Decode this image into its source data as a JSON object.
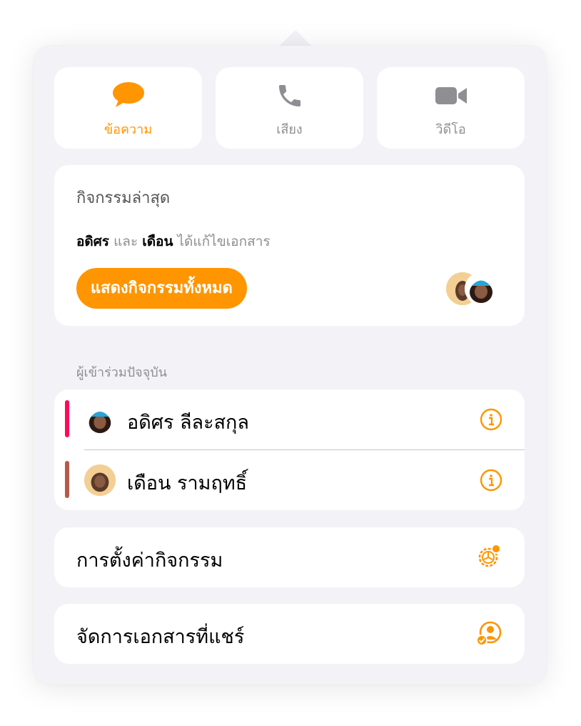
{
  "comm_buttons": [
    {
      "label": "ข้อความ",
      "icon": "message-bubble-icon",
      "active": true
    },
    {
      "label": "เสียง",
      "icon": "phone-icon",
      "active": false
    },
    {
      "label": "วิดีโอ",
      "icon": "video-camera-icon",
      "active": false
    }
  ],
  "activity": {
    "title": "กิจกรรมล่าสุด",
    "user1": "อดิศร",
    "and": "และ",
    "user2": "เดือน",
    "action": "ได้แก้ไขเอกสาร",
    "show_all_label": "แสดงกิจกรรมทั้งหมด"
  },
  "participants": {
    "header": "ผู้เข้าร่วมปัจจุบัน",
    "items": [
      {
        "name": "อดิศร ลีละสกุล",
        "color": "#ff0a5a"
      },
      {
        "name": "เดือน รามฤทธิ์",
        "color": "#b85a4b"
      }
    ]
  },
  "settings": {
    "activity_settings_label": "การตั้งค่ากิจกรรม",
    "manage_shared_label": "จัดการเอกสารที่แชร์"
  },
  "colors": {
    "accent": "#ff9500",
    "background": "#f2f2f7"
  }
}
